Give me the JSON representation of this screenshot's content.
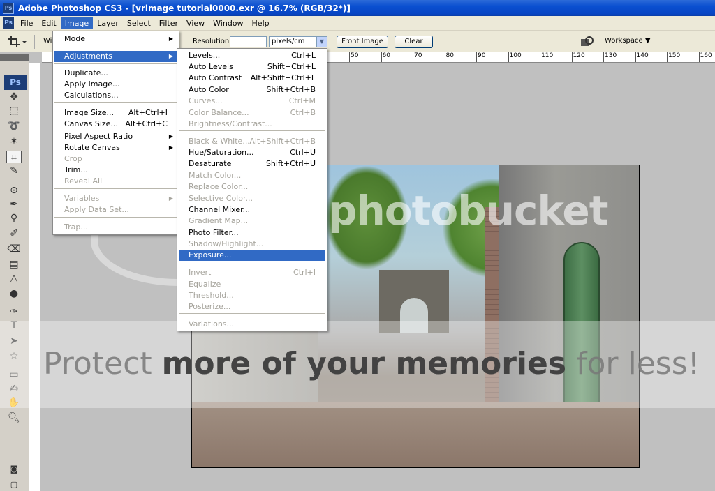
{
  "window": {
    "title": "Adobe Photoshop CS3 - [vrimage tutorial0000.exr @ 16.7% (RGB/32*)]",
    "app_icon": "Ps"
  },
  "menubar": {
    "items": [
      "File",
      "Edit",
      "Image",
      "Layer",
      "Select",
      "Filter",
      "View",
      "Window",
      "Help"
    ],
    "active": "Image"
  },
  "options": {
    "width_label": "Wi",
    "resolution_label": "Resolution:",
    "resolution_value": "",
    "units_value": "pixels/cm",
    "front_image_label": "Front Image",
    "clear_label": "Clear",
    "workspace_label": "Workspace ▼"
  },
  "ruler": {
    "labels": [
      "50",
      "60",
      "70",
      "80",
      "90",
      "100",
      "110",
      "120",
      "130",
      "140",
      "150",
      "160"
    ]
  },
  "toolbox": {
    "logo": "Ps"
  },
  "image_menu": {
    "items": [
      {
        "label": "Mode",
        "submenu": true
      },
      {
        "label": "Adjustments",
        "submenu": true,
        "highlight": true
      },
      {
        "label": "Duplicate..."
      },
      {
        "label": "Apply Image..."
      },
      {
        "label": "Calculations..."
      },
      {
        "label": "Image Size...",
        "shortcut": "Alt+Ctrl+I"
      },
      {
        "label": "Canvas Size...",
        "shortcut": "Alt+Ctrl+C"
      },
      {
        "label": "Pixel Aspect Ratio",
        "submenu": true
      },
      {
        "label": "Rotate Canvas",
        "submenu": true
      },
      {
        "label": "Crop",
        "disabled": true
      },
      {
        "label": "Trim..."
      },
      {
        "label": "Reveal All",
        "disabled": true
      },
      {
        "label": "Variables",
        "submenu": true,
        "disabled": true
      },
      {
        "label": "Apply Data Set...",
        "disabled": true
      },
      {
        "label": "Trap...",
        "disabled": true
      }
    ]
  },
  "adjustments_menu": {
    "items": [
      {
        "label": "Levels...",
        "shortcut": "Ctrl+L"
      },
      {
        "label": "Auto Levels",
        "shortcut": "Shift+Ctrl+L"
      },
      {
        "label": "Auto Contrast",
        "shortcut": "Alt+Shift+Ctrl+L"
      },
      {
        "label": "Auto Color",
        "shortcut": "Shift+Ctrl+B"
      },
      {
        "label": "Curves...",
        "shortcut": "Ctrl+M",
        "disabled": true
      },
      {
        "label": "Color Balance...",
        "shortcut": "Ctrl+B",
        "disabled": true
      },
      {
        "label": "Brightness/Contrast...",
        "disabled": true
      },
      {
        "label": "Black & White...",
        "shortcut": "Alt+Shift+Ctrl+B",
        "disabled": true
      },
      {
        "label": "Hue/Saturation...",
        "shortcut": "Ctrl+U"
      },
      {
        "label": "Desaturate",
        "shortcut": "Shift+Ctrl+U"
      },
      {
        "label": "Match Color...",
        "disabled": true
      },
      {
        "label": "Replace Color...",
        "disabled": true
      },
      {
        "label": "Selective Color...",
        "disabled": true
      },
      {
        "label": "Channel Mixer..."
      },
      {
        "label": "Gradient Map...",
        "disabled": true
      },
      {
        "label": "Photo Filter..."
      },
      {
        "label": "Shadow/Highlight...",
        "disabled": true
      },
      {
        "label": "Exposure...",
        "highlight": true
      },
      {
        "label": "Invert",
        "shortcut": "Ctrl+I",
        "disabled": true
      },
      {
        "label": "Equalize",
        "disabled": true
      },
      {
        "label": "Threshold...",
        "disabled": true
      },
      {
        "label": "Posterize...",
        "disabled": true
      },
      {
        "label": "Variations...",
        "disabled": true
      }
    ]
  },
  "watermark": {
    "logo": "photobucket",
    "band_text_1": "Protect ",
    "band_text_bold_1": "more of your memories",
    "band_text_2": " for less!"
  },
  "colors": {
    "foreground": "#cc7370",
    "background": "#f2ee00",
    "highlight": "#316ac5"
  }
}
